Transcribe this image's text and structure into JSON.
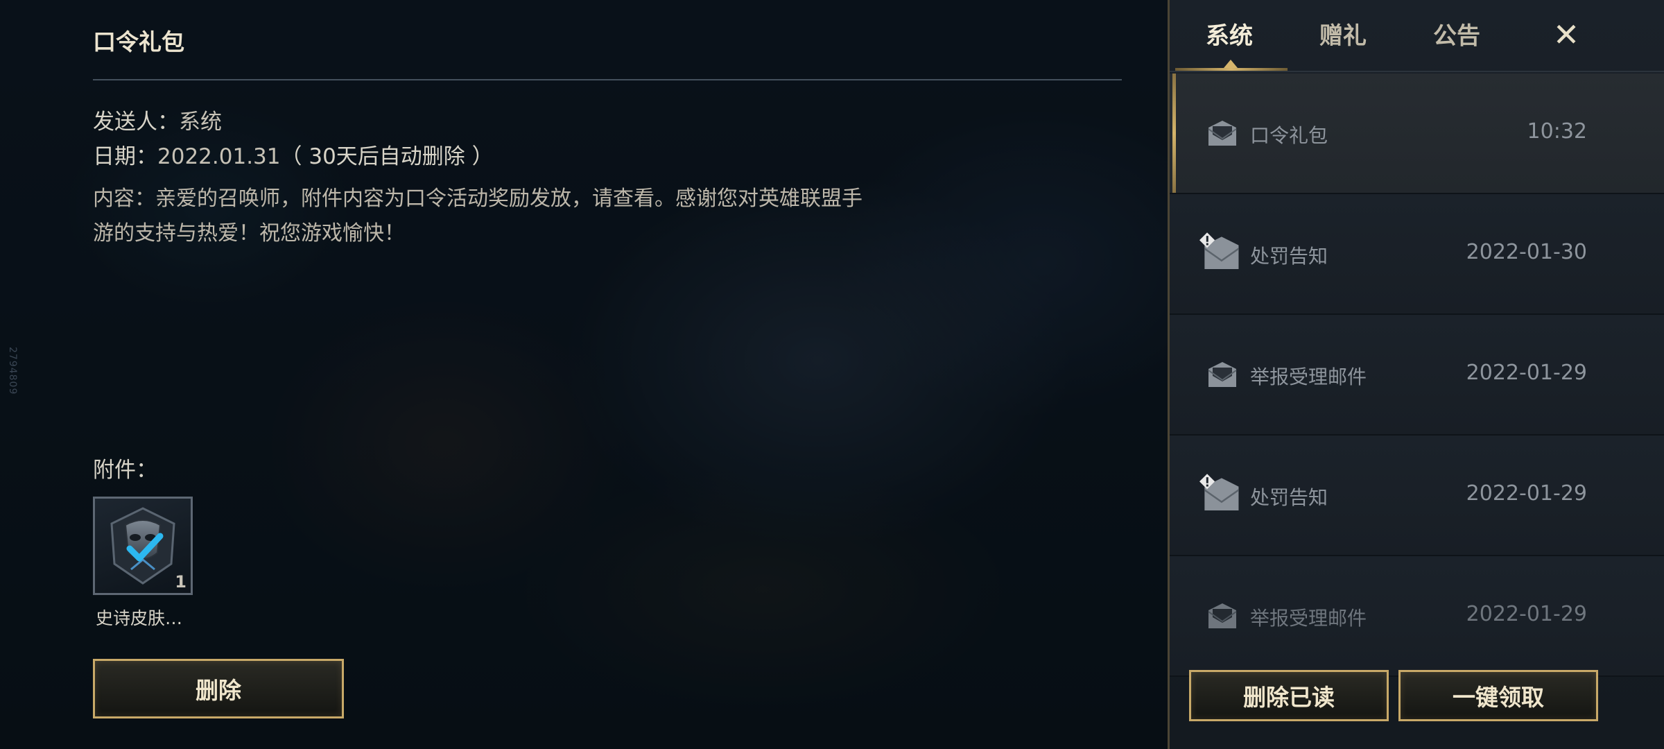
{
  "side_watermark": "2794809",
  "detail": {
    "title": "口令礼包",
    "sender_label": "发送人：",
    "sender": "系统",
    "date_label": "日期：",
    "date": "2022.01.31",
    "auto_delete_note": "（ 30天后自动删除 ）",
    "content": "内容：亲爱的召唤师，附件内容为口令活动奖励发放，请查看。感谢您对英雄联盟手游的支持与热爱！祝您游戏愉快！",
    "attachments_label": "附件：",
    "attachment": {
      "name": "史诗皮肤…",
      "count": "1",
      "icon": "epic-skin-chest-icon"
    },
    "delete_button": "删除"
  },
  "panel": {
    "tabs": [
      "系统",
      "赠礼",
      "公告"
    ],
    "active_tab": 0,
    "close_label": "✕",
    "mails": [
      {
        "subject": "口令礼包",
        "date": "10:32",
        "icon": "mail-open-icon"
      },
      {
        "subject": "处罚告知",
        "date": "2022-01-30",
        "icon": "mail-warning-icon"
      },
      {
        "subject": "举报受理邮件",
        "date": "2022-01-29",
        "icon": "mail-open-icon"
      },
      {
        "subject": "处罚告知",
        "date": "2022-01-29",
        "icon": "mail-warning-icon"
      },
      {
        "subject": "举报受理邮件",
        "date": "2022-01-29",
        "icon": "mail-open-icon"
      }
    ],
    "delete_read_button": "删除已读",
    "claim_all_button": "一键领取"
  },
  "colors": {
    "accent_gold": "#c8a968",
    "panel_bg": "#1a2129",
    "text_primary": "#ece4cf"
  }
}
